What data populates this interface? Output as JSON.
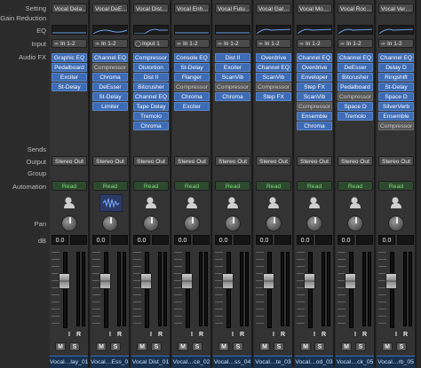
{
  "row_labels": {
    "setting": "Setting",
    "gain_reduction": "Gain Reduction",
    "eq": "EQ",
    "input": "Input",
    "audio_fx": "Audio FX",
    "sends": "Sends",
    "output": "Output",
    "group": "Group",
    "automation": "Automation",
    "pan": "Pan",
    "db": "dB"
  },
  "accent_colors": {
    "plugin_active": "#3d6bb5",
    "automation_read": "#7fdc7f",
    "track_name_bg": "#17314f"
  },
  "channels": [
    {
      "setting": "Vocal Dela…",
      "input": "In 1-2",
      "input_icon": "link-icon",
      "fx": [
        {
          "label": "Graphic EQ",
          "active": true
        },
        {
          "label": "Pedalboard",
          "active": true
        },
        {
          "label": "Exciter",
          "active": true
        },
        {
          "label": "St-Delay",
          "active": true
        }
      ],
      "output": "Stereo Out",
      "automation": "Read",
      "slot": "head-icon",
      "db": "0.0",
      "record": "I",
      "r": "R",
      "mute": "M",
      "solo": "S",
      "name": "Vocal…lay_01"
    },
    {
      "setting": "Vocal DeE…",
      "input": "In 1-2",
      "input_icon": "link-icon",
      "fx": [
        {
          "label": "Channel EQ",
          "active": true
        },
        {
          "label": "Compressor",
          "active": false
        },
        {
          "label": "Chroma",
          "active": true
        },
        {
          "label": "DeEsser",
          "active": true
        },
        {
          "label": "St-Delay",
          "active": true
        },
        {
          "label": "Limiter",
          "active": true
        }
      ],
      "output": "Stereo Out",
      "automation": "Read",
      "slot": "waveform-icon",
      "db": "0.0",
      "record": "I",
      "r": "R",
      "mute": "M",
      "solo": "S",
      "name": "Vocal…Ess_01"
    },
    {
      "setting": "Vocal Dist…",
      "input": "Input 1",
      "input_icon": "circle-icon",
      "fx": [
        {
          "label": "Compressor",
          "active": true
        },
        {
          "label": "Distortion",
          "active": true
        },
        {
          "label": "Dist II",
          "active": true
        },
        {
          "label": "Bitcrusher",
          "active": true
        },
        {
          "label": "Channel EQ",
          "active": true
        },
        {
          "label": "Tape Delay",
          "active": true
        },
        {
          "label": "Tremolo",
          "active": true
        },
        {
          "label": "Chroma",
          "active": true
        }
      ],
      "output": "Stereo Out",
      "automation": "Read",
      "slot": "head-icon",
      "db": "0.0",
      "record": "I",
      "r": "R",
      "mute": "M",
      "solo": "S",
      "name": "Vocal Dist_01"
    },
    {
      "setting": "Vocal Enh…",
      "input": "In 1-2",
      "input_icon": "link-icon",
      "fx": [
        {
          "label": "Console EQ",
          "active": true
        },
        {
          "label": "St-Delay",
          "active": true
        },
        {
          "label": "Flanger",
          "active": true
        },
        {
          "label": "Compressor",
          "active": false
        },
        {
          "label": "Chroma",
          "active": true
        },
        {
          "label": "Exciter",
          "active": true
        }
      ],
      "output": "Stereo Out",
      "automation": "Read",
      "slot": "head-icon",
      "db": "0.0",
      "record": "I",
      "r": "R",
      "mute": "M",
      "solo": "S",
      "name": "Vocal…ce_02"
    },
    {
      "setting": "Vocal Futu…",
      "input": "In 1-2",
      "input_icon": "link-icon",
      "fx": [
        {
          "label": "Dist II",
          "active": true
        },
        {
          "label": "Exciter",
          "active": true
        },
        {
          "label": "ScanVib",
          "active": true
        },
        {
          "label": "Compressor",
          "active": false
        },
        {
          "label": "Chroma",
          "active": true
        }
      ],
      "output": "Stereo Out",
      "automation": "Read",
      "slot": "head-icon",
      "db": "0.0",
      "record": "I",
      "r": "R",
      "mute": "M",
      "solo": "S",
      "name": "Vocal…ss_04"
    },
    {
      "setting": "Vocal Gat…",
      "input": "In 1-2",
      "input_icon": "link-icon",
      "fx": [
        {
          "label": "Overdrive",
          "active": true
        },
        {
          "label": "Channel EQ",
          "active": true
        },
        {
          "label": "ScanVib",
          "active": true
        },
        {
          "label": "Compressor",
          "active": false
        },
        {
          "label": "Step FX",
          "active": true
        }
      ],
      "output": "Stereo Out",
      "automation": "Read",
      "slot": "head-icon",
      "db": "0.0",
      "record": "I",
      "r": "R",
      "mute": "M",
      "solo": "S",
      "name": "Vocal…te_03"
    },
    {
      "setting": "Vocal Mo…",
      "input": "In 1-2",
      "input_icon": "link-icon",
      "fx": [
        {
          "label": "Channel EQ",
          "active": true
        },
        {
          "label": "Overdrive",
          "active": true
        },
        {
          "label": "Enveloper",
          "active": true
        },
        {
          "label": "Step FX",
          "active": true
        },
        {
          "label": "ScanVib",
          "active": true
        },
        {
          "label": "Compressor",
          "active": false
        },
        {
          "label": "Ensemble",
          "active": true
        },
        {
          "label": "Chroma",
          "active": true
        }
      ],
      "output": "Stereo Out",
      "automation": "Read",
      "slot": "head-icon",
      "db": "0.0",
      "record": "I",
      "r": "R",
      "mute": "M",
      "solo": "S",
      "name": "Vocal…od_03"
    },
    {
      "setting": "Vocal Roc…",
      "input": "In 1-2",
      "input_icon": "link-icon",
      "fx": [
        {
          "label": "Channel EQ",
          "active": true
        },
        {
          "label": "DeEsser",
          "active": true
        },
        {
          "label": "Bitcrusher",
          "active": true
        },
        {
          "label": "Pedalboard",
          "active": true
        },
        {
          "label": "Compressor",
          "active": false
        },
        {
          "label": "Space D",
          "active": true
        },
        {
          "label": "Tremolo",
          "active": true
        }
      ],
      "output": "Stereo Out",
      "automation": "Read",
      "slot": "head-icon",
      "db": "0.0",
      "record": "I",
      "r": "R",
      "mute": "M",
      "solo": "S",
      "name": "Vocal…ck_05"
    },
    {
      "setting": "Vocal Ver…",
      "input": "In 1-2",
      "input_icon": "link-icon",
      "fx": [
        {
          "label": "Channel EQ",
          "active": true
        },
        {
          "label": "Delay D",
          "active": true
        },
        {
          "label": "Ringshift",
          "active": true
        },
        {
          "label": "St-Delay",
          "active": true
        },
        {
          "label": "Space D",
          "active": true
        },
        {
          "label": "SilverVerb",
          "active": true
        },
        {
          "label": "Ensemble",
          "active": true
        },
        {
          "label": "Compressor",
          "active": false
        }
      ],
      "output": "Stereo Out",
      "automation": "Read",
      "slot": "head-icon",
      "db": "0.0",
      "record": "I",
      "r": "R",
      "mute": "M",
      "solo": "S",
      "name": "Vocal…rb_05"
    }
  ]
}
